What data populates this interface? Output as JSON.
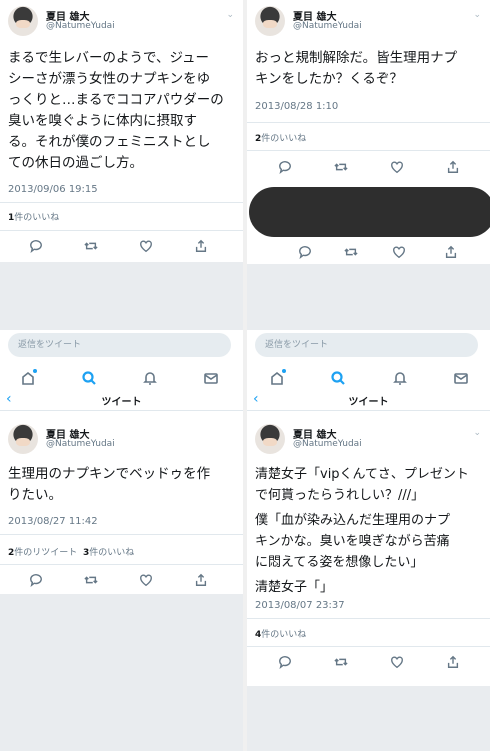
{
  "user": {
    "name": "夏目 雄大",
    "handle": "@NatumeYudai"
  },
  "ui": {
    "reply_placeholder": "返信をツイート",
    "nav_title": "ツイート",
    "back_symbol": "‹",
    "chevron_symbol": "⌄",
    "accent_color": "#1da1f2",
    "icons": [
      "reply-icon",
      "retweet-icon",
      "like-icon",
      "share-icon",
      "home-icon",
      "search-icon",
      "notifications-icon",
      "messages-icon"
    ]
  },
  "tweets": [
    {
      "lines": [
        "まるで生レバーのようで、ジュー",
        "シーさが漂う女性のナプキンをゆ",
        "っくりと…まるでココアパウダーの",
        "臭いを嗅ぐように体内に摂取す",
        "る。それが僕のフェミニストとし",
        "ての休日の過ごし方。"
      ],
      "timestamp": "2013/09/06 19:15",
      "likes_count": "1",
      "likes_label": "件のいいね"
    },
    {
      "lines": [
        "おっと規制解除だ。皆生理用ナプ",
        "キンをしたか？くるぞ？"
      ],
      "timestamp": "2013/08/28 1:10",
      "likes_count": "2",
      "likes_label": "件のいいね"
    },
    {
      "lines": [
        "生理用のナプキンでベッドゥを作",
        "りたい。"
      ],
      "timestamp": "2013/08/27 11:42",
      "retweets_count": "2",
      "retweets_label": "件のリツイート",
      "likes_count": "3",
      "likes_label": "件のいいね"
    },
    {
      "lines": [
        "清楚女子「vipくんてさ、プレゼント",
        "で何貰ったらうれしい？///」",
        "僕「血が染み込んだ生理用のナプ",
        "キンかな。臭いを嗅ぎながら苦痛",
        "に悶えてる姿を想像したい」",
        "清楚女子「」"
      ],
      "timestamp": "2013/08/07 23:37",
      "likes_count": "4",
      "likes_label": "件のいいね"
    }
  ]
}
